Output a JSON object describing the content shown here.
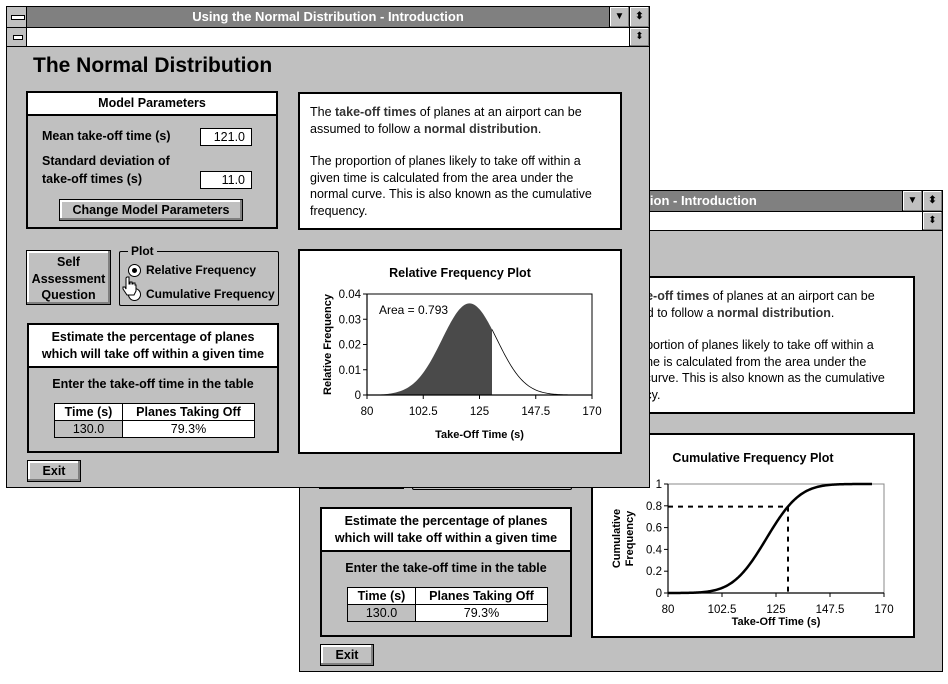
{
  "window": {
    "title": "Using the Normal Distribution - Introduction",
    "minimize_icon": "triangle-down",
    "maximize_icon": "updown-arrows"
  },
  "heading": "The Normal Distribution",
  "model_params": {
    "header": "Model Parameters",
    "mean_label": "Mean take-off time (s)",
    "mean_value": "121.0",
    "sd_label_line1": "Standard deviation of",
    "sd_label_line2": "take-off times (s)",
    "sd_value": "11.0",
    "change_button": "Change Model Parameters"
  },
  "info": {
    "p1": [
      "The ",
      "take-off times",
      " of planes at an airport can be assumed to follow a ",
      "normal distribution",
      "."
    ],
    "p2": "The proportion of planes likely to take off within a given time is calculated from the area under the normal curve. This is also known as the cumulative frequency."
  },
  "self_assessment": [
    "Self",
    "Assessment",
    "Question"
  ],
  "plot_group": {
    "label": "Plot",
    "options": [
      {
        "label": "Relative Frequency",
        "selected": true
      },
      {
        "label": "Cumulative Frequency",
        "selected": false
      }
    ]
  },
  "estimate": {
    "header_line1": "Estimate the percentage of planes",
    "header_line2": "which will take off within a given time",
    "instruction": "Enter the take-off time in the table",
    "table": {
      "headers": [
        "Time (s)",
        "Planes Taking Off"
      ],
      "rows": [
        [
          "130.0",
          "79.3%"
        ]
      ]
    }
  },
  "exit_label": "Exit",
  "colors": {
    "titlebar": "#808080",
    "window_bg": "#c0c0c0",
    "shaded_area": "#4a4a4a"
  },
  "chart_data": [
    {
      "type": "area",
      "title": "Relative Frequency Plot",
      "xlabel": "Take-Off Time (s)",
      "ylabel": [
        "Relative Frequency"
      ],
      "xlim": [
        80,
        170
      ],
      "ylim": [
        0,
        0.04
      ],
      "xticks": [
        80,
        102.5,
        125,
        147.5,
        170
      ],
      "yticks": [
        0,
        0.01,
        0.02,
        0.03,
        0.04
      ],
      "mean": 121,
      "sd": 11,
      "curve_x_range": [
        80,
        165
      ],
      "shaded_upto": 130,
      "annotation": "Area = 0.793",
      "grid": false
    },
    {
      "type": "line",
      "title": "Cumulative Frequency Plot",
      "xlabel": "Take-Off Time (s)",
      "ylabel": [
        "Cumulative",
        "Frequency"
      ],
      "xlim": [
        80,
        170
      ],
      "ylim": [
        0,
        1
      ],
      "xticks": [
        80,
        102.5,
        125,
        147.5,
        170
      ],
      "yticks": [
        0,
        0.2,
        0.4,
        0.6,
        0.8,
        1
      ],
      "mean": 121,
      "sd": 11,
      "curve_x_range": [
        80,
        165
      ],
      "reference": {
        "x": 130,
        "y": 0.793
      },
      "grid": false
    }
  ]
}
